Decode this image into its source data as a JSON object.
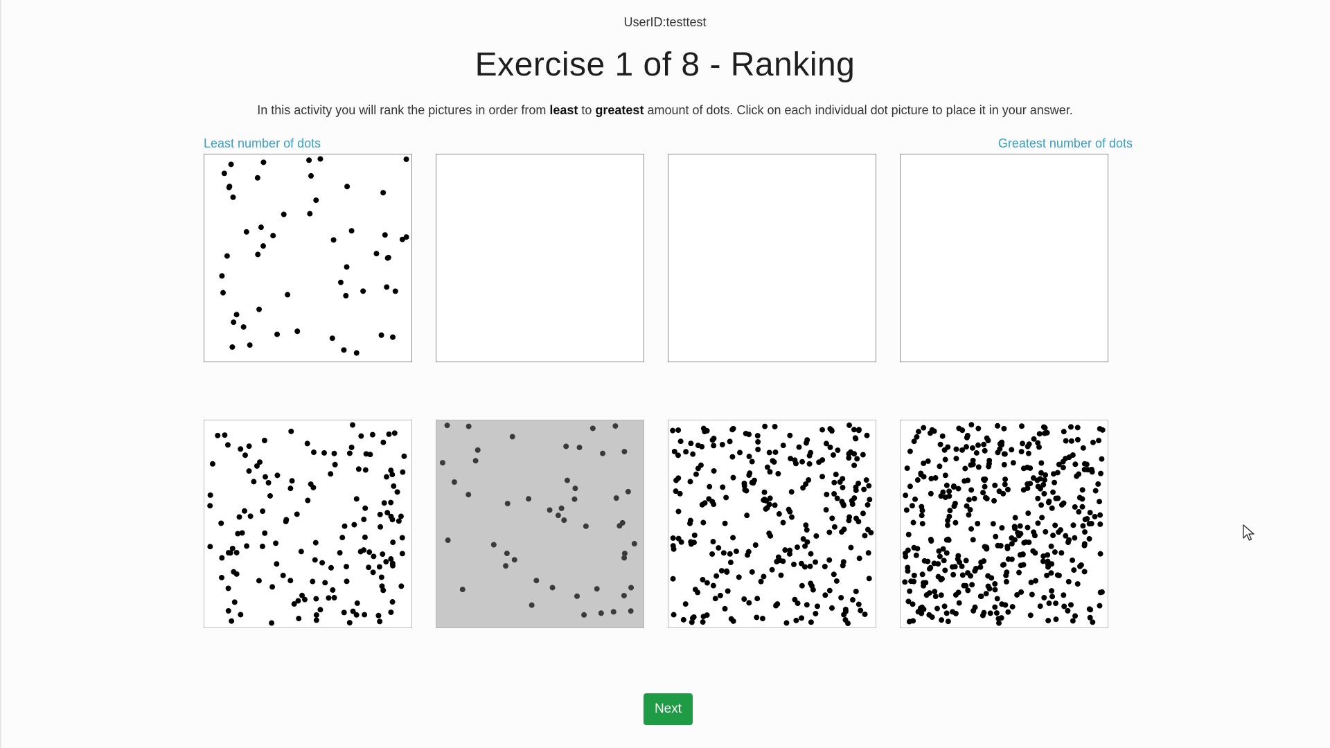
{
  "header": {
    "user_id": "UserID:testtest",
    "title": "Exercise 1 of 8 - Ranking"
  },
  "instructions": {
    "part1": "In this activity you will rank the pictures in order from ",
    "least": "least",
    "part2": " to ",
    "greatest": "greatest",
    "part3": " amount of dots. Click on each individual dot picture to place it in your answer."
  },
  "answer_row": {
    "least_label": "Least number of dots",
    "greatest_label": "Greatest number of dots",
    "slots": [
      {
        "filled": true,
        "dot_count": 52
      },
      {
        "filled": false
      },
      {
        "filled": false
      },
      {
        "filled": false
      }
    ]
  },
  "choices": [
    {
      "dot_count": 150,
      "selected": false
    },
    {
      "dot_count": 48,
      "selected": true
    },
    {
      "dot_count": 280,
      "selected": false
    },
    {
      "dot_count": 420,
      "selected": false
    }
  ],
  "colors": {
    "accent_link": "#3a9fc5",
    "next_button": "#1f9a45",
    "selected_tile": "#c8c8c8"
  },
  "next_button": {
    "label": "Next"
  }
}
